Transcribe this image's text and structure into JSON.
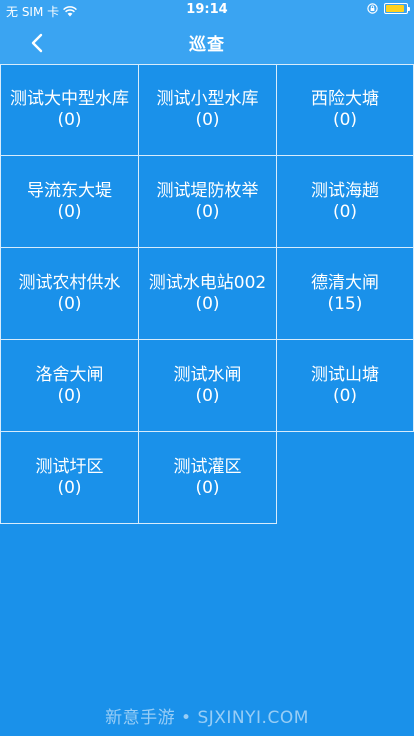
{
  "status_bar": {
    "carrier": "无 SIM 卡",
    "time": "19:14"
  },
  "nav": {
    "title": "巡查"
  },
  "items": [
    {
      "name": "测试大中型水库",
      "count": "(0)"
    },
    {
      "name": "测试小型水库",
      "count": "(0)"
    },
    {
      "name": "西险大塘",
      "count": "(0)"
    },
    {
      "name": "导流东大堤",
      "count": "(0)"
    },
    {
      "name": "测试堤防枚举",
      "count": "(0)"
    },
    {
      "name": "测试海趟",
      "count": "(0)"
    },
    {
      "name": "测试农村供水",
      "count": "(0)"
    },
    {
      "name": "测试水电站002",
      "count": "(0)"
    },
    {
      "name": "德清大闸",
      "count": "(15)"
    },
    {
      "name": "洛舍大闸",
      "count": "(0)"
    },
    {
      "name": "测试水闸",
      "count": "(0)"
    },
    {
      "name": "测试山塘",
      "count": "(0)"
    },
    {
      "name": "测试圩区",
      "count": "(0)"
    },
    {
      "name": "测试灌区",
      "count": "(0)"
    }
  ],
  "watermark": "新意手游 • SJXINYI.COM",
  "colors": {
    "background": "#1a91ea",
    "header": "#3aa4f2",
    "cell_border": "#d7ecfc",
    "battery": "#ffd21f"
  }
}
